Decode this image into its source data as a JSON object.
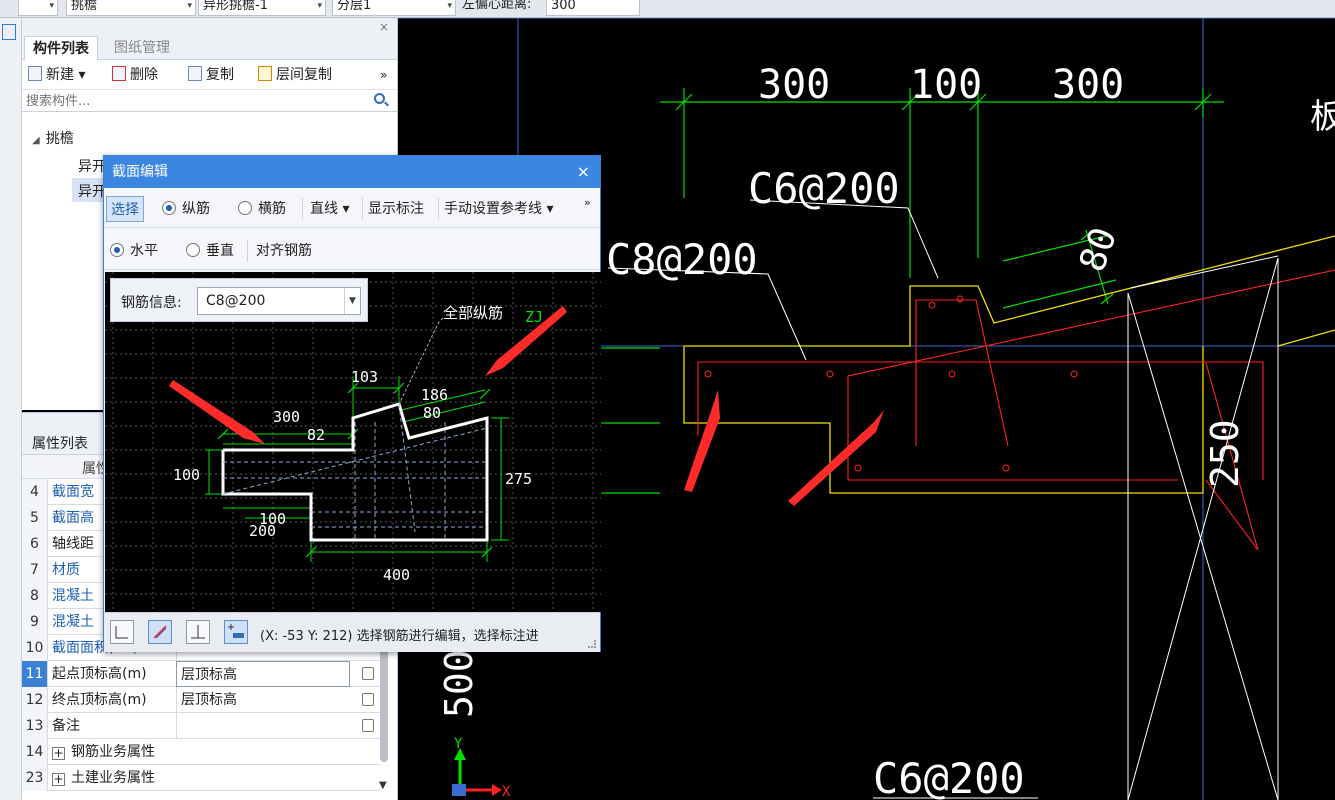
{
  "toolbar": {
    "combo1": "▾",
    "combo2": "挑檐",
    "combo3": "异形挑檐-1",
    "combo4": "分层1",
    "offset_label": "左偏心距离:",
    "offset_value": "300"
  },
  "component_panel": {
    "tab_active": "构件列表",
    "tab_inactive": "图纸管理",
    "close": "×",
    "actions": {
      "new": "新建 ▾",
      "delete": "删除",
      "copy": "复制",
      "floor_copy": "层间复制",
      "more": "»"
    },
    "search_placeholder": "搜索构件...",
    "tree": {
      "category": "挑檐",
      "items": [
        "异开",
        "异开"
      ]
    }
  },
  "property_panel": {
    "title": "属性列表",
    "col_name": "属性",
    "rows": [
      {
        "num": "4",
        "name": "截面宽",
        "value": "",
        "link": true
      },
      {
        "num": "5",
        "name": "截面高",
        "value": "",
        "link": true
      },
      {
        "num": "6",
        "name": "轴线距",
        "value": "",
        "link": false
      },
      {
        "num": "7",
        "name": "材质",
        "value": "",
        "link": true
      },
      {
        "num": "8",
        "name": "混凝土",
        "value": "",
        "link": true
      },
      {
        "num": "9",
        "name": "混凝土",
        "value": "",
        "link": true
      },
      {
        "num": "10",
        "name": "截面面积(m²)",
        "value": "",
        "link": true
      },
      {
        "num": "11",
        "name": "起点顶标高(m)",
        "value": "层顶标高",
        "link": false
      },
      {
        "num": "12",
        "name": "终点顶标高(m)",
        "value": "层顶标高",
        "link": false
      },
      {
        "num": "13",
        "name": "备注",
        "value": "",
        "link": false
      },
      {
        "num": "14",
        "name": "钢筋业务属性",
        "value": "",
        "link": false,
        "group": true
      },
      {
        "num": "23",
        "name": "土建业务属性",
        "value": "",
        "link": false,
        "group": true
      }
    ]
  },
  "dialog": {
    "title": "截面编辑",
    "close": "×",
    "toolbar1": {
      "select": "选择",
      "longitudinal": "纵筋",
      "transverse": "横筋",
      "line": "直线 ▾",
      "show_dims": "显示标注",
      "ref_line": "手动设置参考线 ▾",
      "more": "»"
    },
    "toolbar2": {
      "horizontal": "水平",
      "vertical": "垂直",
      "align": "对齐钢筋"
    },
    "rebar_label": "钢筋信息:",
    "rebar_value": "C8@200",
    "annotation": "全部纵筋",
    "annotation_code": "ZJ",
    "dims": [
      "103",
      "186",
      "80",
      "300",
      "82",
      "100",
      "275",
      "100",
      "200",
      "400"
    ],
    "status_text": "(X: -53 Y: 212) 选择钢筋进行编辑，选择标注进"
  },
  "cad": {
    "dims_top": [
      "300",
      "100",
      "300"
    ],
    "labels": [
      "C6@200",
      "C8@200",
      "C6@200",
      "80",
      "250",
      "500",
      "Y",
      "X",
      "板"
    ],
    "colors": {
      "green": "#00e000",
      "red": "#ff2020",
      "yellow": "#f0e000",
      "white": "#ffffff",
      "blue": "#4a7fe0"
    }
  }
}
